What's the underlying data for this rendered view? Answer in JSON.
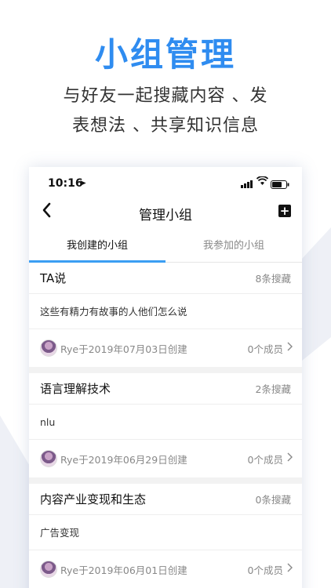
{
  "promo": {
    "title": "小组管理",
    "subtitle_line1": "与好友一起搜藏内容 、发",
    "subtitle_line2": "表想法 、共享知识信息"
  },
  "status_bar": {
    "time": "10:16"
  },
  "navbar": {
    "title": "管理小组",
    "back_icon": "chevron-left-icon",
    "add_icon": "plus-square-icon"
  },
  "tabs": [
    {
      "label": "我创建的小组",
      "active": true
    },
    {
      "label": "我参加的小组",
      "active": false
    }
  ],
  "groups": [
    {
      "name": "TA说",
      "count": "8条搜藏",
      "description": "这些有精力有故事的人他们怎么说",
      "creator": "Rye于2019年07月03日创建",
      "members": "0个成员"
    },
    {
      "name": "语言理解技术",
      "count": "2条搜藏",
      "description": "nlu",
      "creator": "Rye于2019年06月29日创建",
      "members": "0个成员"
    },
    {
      "name": "内容产业变现和生态",
      "count": "0条搜藏",
      "description": "广告变现",
      "creator": "Rye于2019年06月01日创建",
      "members": "0个成员"
    }
  ],
  "colors": {
    "accent": "#2f8cf0",
    "tab_indicator": "#3b9ef3"
  }
}
